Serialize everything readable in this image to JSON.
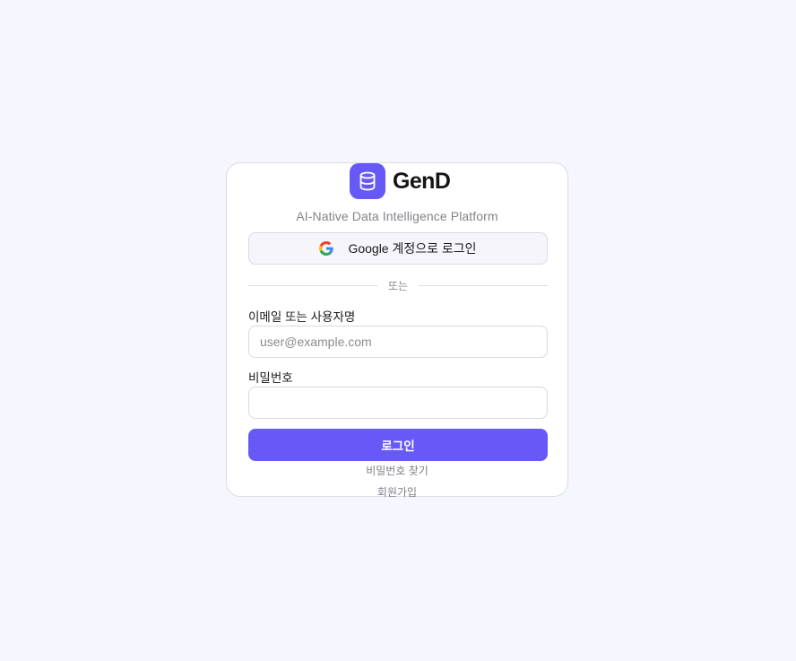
{
  "brand": {
    "name": "GenD",
    "tagline": "AI-Native Data Intelligence Platform",
    "icon": "database-icon",
    "accent_color": "#6659f7"
  },
  "google_login": {
    "label": "Google 계정으로 로그인",
    "icon": "google-icon"
  },
  "divider": {
    "text": "또는"
  },
  "form": {
    "username_label": "이메일 또는 사용자명",
    "username_placeholder": "user@example.com",
    "username_value": "",
    "password_label": "비밀번호",
    "password_value": "",
    "submit_label": "로그인"
  },
  "links": {
    "forgot_password": "비밀번호 찾기",
    "signup": "회원가입"
  }
}
